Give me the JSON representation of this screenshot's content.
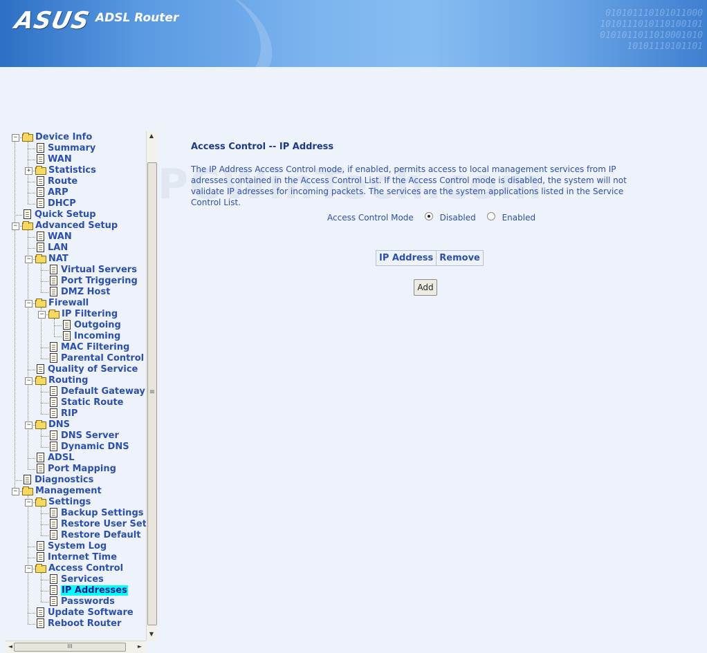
{
  "header": {
    "logo": "ASUS",
    "product": "ADSL Router",
    "binary_lines": [
      "010101110101011000",
      "1010111010110100101",
      "0101011011010001010",
      "10101110101101"
    ]
  },
  "tree": [
    {
      "label": "Device Info",
      "depth": 0,
      "type": "folder",
      "expander": "minus"
    },
    {
      "label": "Summary",
      "depth": 1,
      "type": "doc"
    },
    {
      "label": "WAN",
      "depth": 1,
      "type": "doc"
    },
    {
      "label": "Statistics",
      "depth": 1,
      "type": "folder",
      "expander": "plus"
    },
    {
      "label": "Route",
      "depth": 1,
      "type": "doc"
    },
    {
      "label": "ARP",
      "depth": 1,
      "type": "doc"
    },
    {
      "label": "DHCP",
      "depth": 1,
      "type": "doc"
    },
    {
      "label": "Quick Setup",
      "depth": 0,
      "type": "doc"
    },
    {
      "label": "Advanced Setup",
      "depth": 0,
      "type": "folder",
      "expander": "minus"
    },
    {
      "label": "WAN",
      "depth": 1,
      "type": "doc"
    },
    {
      "label": "LAN",
      "depth": 1,
      "type": "doc"
    },
    {
      "label": "NAT",
      "depth": 1,
      "type": "folder",
      "expander": "minus"
    },
    {
      "label": "Virtual Servers",
      "depth": 2,
      "type": "doc"
    },
    {
      "label": "Port Triggering",
      "depth": 2,
      "type": "doc"
    },
    {
      "label": "DMZ Host",
      "depth": 2,
      "type": "doc"
    },
    {
      "label": "Firewall",
      "depth": 1,
      "type": "folder",
      "expander": "minus"
    },
    {
      "label": "IP Filtering",
      "depth": 2,
      "type": "folder",
      "expander": "minus"
    },
    {
      "label": "Outgoing",
      "depth": 3,
      "type": "doc"
    },
    {
      "label": "Incoming",
      "depth": 3,
      "type": "doc"
    },
    {
      "label": "MAC Filtering",
      "depth": 2,
      "type": "doc"
    },
    {
      "label": "Parental Control",
      "depth": 2,
      "type": "doc"
    },
    {
      "label": "Quality of Service",
      "depth": 1,
      "type": "doc"
    },
    {
      "label": "Routing",
      "depth": 1,
      "type": "folder",
      "expander": "minus"
    },
    {
      "label": "Default Gateway",
      "depth": 2,
      "type": "doc"
    },
    {
      "label": "Static Route",
      "depth": 2,
      "type": "doc"
    },
    {
      "label": "RIP",
      "depth": 2,
      "type": "doc"
    },
    {
      "label": "DNS",
      "depth": 1,
      "type": "folder",
      "expander": "minus"
    },
    {
      "label": "DNS Server",
      "depth": 2,
      "type": "doc"
    },
    {
      "label": "Dynamic DNS",
      "depth": 2,
      "type": "doc"
    },
    {
      "label": "ADSL",
      "depth": 1,
      "type": "doc"
    },
    {
      "label": "Port Mapping",
      "depth": 1,
      "type": "doc"
    },
    {
      "label": "Diagnostics",
      "depth": 0,
      "type": "doc"
    },
    {
      "label": "Management",
      "depth": 0,
      "type": "folder",
      "expander": "minus"
    },
    {
      "label": "Settings",
      "depth": 1,
      "type": "folder",
      "expander": "minus"
    },
    {
      "label": "Backup Settings",
      "depth": 2,
      "type": "doc"
    },
    {
      "label": "Restore User Settin",
      "depth": 2,
      "type": "doc"
    },
    {
      "label": "Restore Default",
      "depth": 2,
      "type": "doc"
    },
    {
      "label": "System Log",
      "depth": 1,
      "type": "doc"
    },
    {
      "label": "Internet Time",
      "depth": 1,
      "type": "doc"
    },
    {
      "label": "Access Control",
      "depth": 1,
      "type": "folder",
      "expander": "minus"
    },
    {
      "label": "Services",
      "depth": 2,
      "type": "doc"
    },
    {
      "label": "IP Addresses",
      "depth": 2,
      "type": "doc",
      "selected": true
    },
    {
      "label": "Passwords",
      "depth": 2,
      "type": "doc"
    },
    {
      "label": "Update Software",
      "depth": 1,
      "type": "doc"
    },
    {
      "label": "Reboot Router",
      "depth": 1,
      "type": "doc"
    }
  ],
  "scroll": {
    "up": "▲",
    "down": "▼",
    "left": "◄",
    "right": "►",
    "grip": "≡",
    "hgrip": "III"
  },
  "watermark": "PCWinTech.com",
  "main": {
    "title": "Access Control -- IP Address",
    "description": "The IP Address Access Control mode, if enabled, permits access to local management services from IP adresses contained in the Access Control List. If the Access Control mode is disabled, the system will not validate IP adresses for incoming packets. The services are the system applications listed in the Service Control List.",
    "mode_label": "Access Control Mode",
    "options": [
      {
        "label": "Disabled",
        "checked": true
      },
      {
        "label": "Enabled",
        "checked": false
      }
    ],
    "table_headers": [
      "IP Address",
      "Remove"
    ],
    "add_label": "Add"
  },
  "colors": {
    "link": "#2b4fae",
    "selection": "#00ffff",
    "background": "#eef3fb"
  }
}
